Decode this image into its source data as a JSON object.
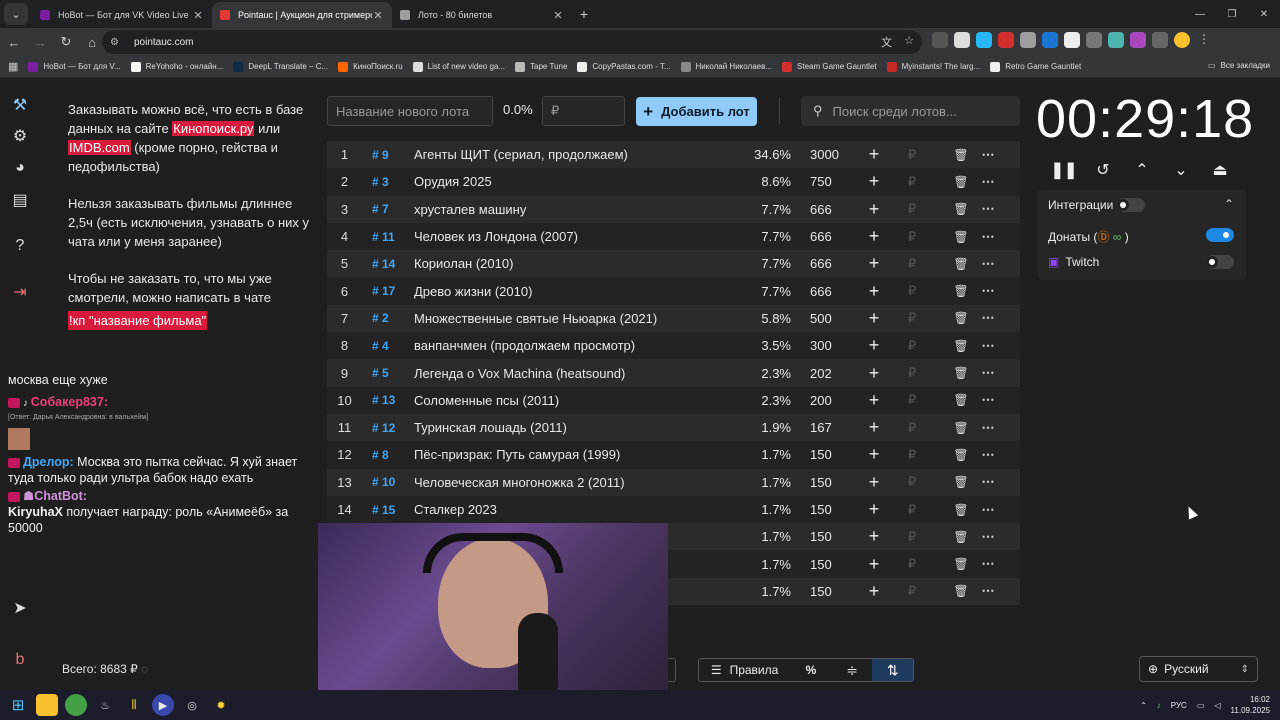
{
  "browser": {
    "tabs": [
      {
        "title": "HoBot — Бот для VK Video Live",
        "color": "#7b1fa2",
        "active": false
      },
      {
        "title": "Pointauc | Аукцион для стримеров",
        "color": "#e53935",
        "active": true
      },
      {
        "title": "Лото - 80 билетов",
        "color": "#9e9e9e",
        "active": false
      }
    ],
    "url": "pointauc.com",
    "bookmarks": [
      {
        "label": "HoBot — Бот для V...",
        "color": "#7b1fa2"
      },
      {
        "label": "ReYohoho - онлайн...",
        "color": "#ffffff"
      },
      {
        "label": "DeepL Translate – C...",
        "color": "#0f2b46"
      },
      {
        "label": "КиноПоиск.ru",
        "color": "#ff6600"
      },
      {
        "label": "List of new video ga...",
        "color": "#dddddd"
      },
      {
        "label": "Tape Tune",
        "color": "#bbbbbb"
      },
      {
        "label": "CopyPastas.com - T...",
        "color": "#eeeeee"
      },
      {
        "label": "Николай Николаев...",
        "color": "#888888"
      },
      {
        "label": "Steam Game Gauntlet",
        "color": "#d32f2f"
      },
      {
        "label": "Myinstants! The larg...",
        "color": "#c62828"
      },
      {
        "label": "Retro Game Gauntlet",
        "color": "#eeeeee"
      }
    ],
    "all_bookmarks": "Все закладки"
  },
  "info": {
    "p1_a": "Заказывать можно всё, что есть в базе данных на сайте ",
    "p1_link1": "Кинопоиск.ру",
    "p1_b": " или ",
    "p1_link2": "IMDB.com",
    "p1_c": " (кроме порно, гейства и педофильства)",
    "p2": "Нельзя заказывать фильмы длиннее 2,5ч (есть исключения, узнавать о них у чата или у меня заранее)",
    "p3": "Чтобы не заказать то, что мы уже смотрели, можно написать в чате",
    "p3_cmd": "!кп \"название фильма\""
  },
  "chat": {
    "m1": "москва еще хуже",
    "m2_user": "Собакер837:",
    "m2_reply": "[Ответ: Дарья Александровна: в вальхейм]",
    "m3_user": "Дрелор:",
    "m3_text": " Москва это пытка сейчас. Я хуй знает туда только ради ультра бабок надо ехать",
    "m4_user": "ChatBot:",
    "m4_bold": "KiryuhaX",
    "m4_text": " получает награду: роль «Анимеёб» за 50000"
  },
  "total": "Всего: 8683 ₽",
  "controls": {
    "new_lot_placeholder": "Название нового лота",
    "percent": "0.0%",
    "amount_placeholder": "₽",
    "add_button": "Добавить лот",
    "search_placeholder": "Поиск среди лотов..."
  },
  "lots": [
    {
      "n": "1",
      "id": "# 9",
      "name": "Агенты ЩИТ (сериал, продолжаем)",
      "pct": "34.6%",
      "amount": "3000"
    },
    {
      "n": "2",
      "id": "# 3",
      "name": "Орудия 2025",
      "pct": "8.6%",
      "amount": "750"
    },
    {
      "n": "3",
      "id": "# 7",
      "name": "хрусталев машину",
      "pct": "7.7%",
      "amount": "666"
    },
    {
      "n": "4",
      "id": "# 11",
      "name": "Человек из Лондона (2007)",
      "pct": "7.7%",
      "amount": "666"
    },
    {
      "n": "5",
      "id": "# 14",
      "name": "Кориолан (2010)",
      "pct": "7.7%",
      "amount": "666"
    },
    {
      "n": "6",
      "id": "# 17",
      "name": "Древо жизни (2010)",
      "pct": "7.7%",
      "amount": "666"
    },
    {
      "n": "7",
      "id": "# 2",
      "name": "Множественные святые Ньюарка (2021)",
      "pct": "5.8%",
      "amount": "500"
    },
    {
      "n": "8",
      "id": "# 4",
      "name": "ванпанчмен (продолжаем просмотр)",
      "pct": "3.5%",
      "amount": "300"
    },
    {
      "n": "9",
      "id": "# 5",
      "name": "Легенда о Vox Machina (heatsound)",
      "pct": "2.3%",
      "amount": "202"
    },
    {
      "n": "10",
      "id": "# 13",
      "name": "Соломенные псы (2011)",
      "pct": "2.3%",
      "amount": "200"
    },
    {
      "n": "11",
      "id": "# 12",
      "name": "Туринская лошадь (2011)",
      "pct": "1.9%",
      "amount": "167"
    },
    {
      "n": "12",
      "id": "# 8",
      "name": "Пёс-призрак: Путь самурая (1999)",
      "pct": "1.7%",
      "amount": "150"
    },
    {
      "n": "13",
      "id": "# 10",
      "name": "Человеческая многоножка 2 (2011)",
      "pct": "1.7%",
      "amount": "150"
    },
    {
      "n": "14",
      "id": "# 15",
      "name": "Сталкер 2023",
      "pct": "1.7%",
      "amount": "150"
    },
    {
      "n": "",
      "id": "",
      "name": "",
      "pct": "1.7%",
      "amount": "150"
    },
    {
      "n": "",
      "id": "",
      "name": "",
      "pct": "1.7%",
      "amount": "150"
    },
    {
      "n": "",
      "id": "",
      "name": "",
      "pct": "1.7%",
      "amount": "150"
    }
  ],
  "timer": "00:29:18",
  "integrations": {
    "title": "Интеграции",
    "donations": "Донаты (",
    "donations_end": ")",
    "twitch": "Twitch"
  },
  "bottom": {
    "rules": "Правила",
    "percent_icon": "%",
    "language": "Русский"
  },
  "taskbar": {
    "lang": "РУС",
    "time": "16:02",
    "date": "11.09.2025"
  }
}
